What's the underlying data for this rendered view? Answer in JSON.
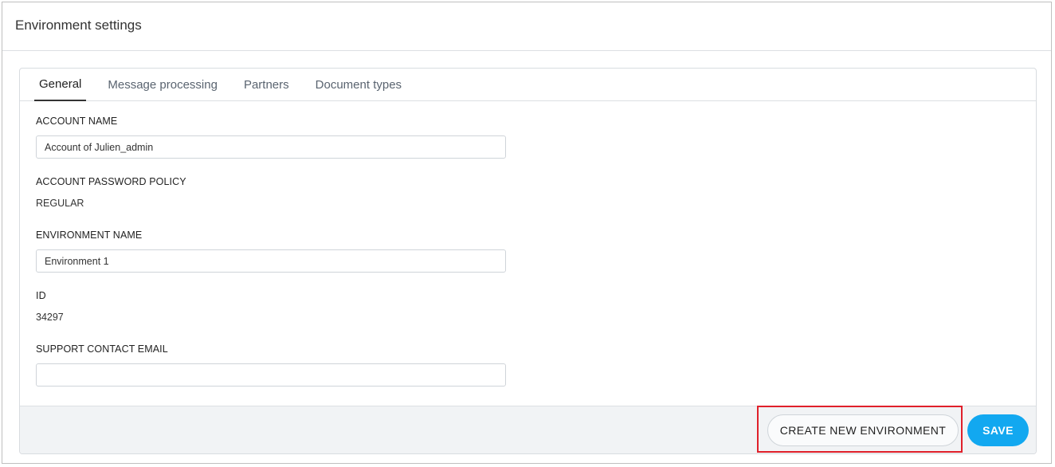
{
  "header": {
    "title": "Environment settings"
  },
  "tabs": [
    {
      "label": "General",
      "active": true
    },
    {
      "label": "Message processing",
      "active": false
    },
    {
      "label": "Partners",
      "active": false
    },
    {
      "label": "Document types",
      "active": false
    }
  ],
  "form": {
    "account_name": {
      "label": "ACCOUNT NAME",
      "value": "Account of Julien_admin"
    },
    "password_policy": {
      "label": "ACCOUNT PASSWORD POLICY",
      "value": "REGULAR"
    },
    "environment_name": {
      "label": "ENVIRONMENT NAME",
      "value": "Environment 1"
    },
    "id": {
      "label": "ID",
      "value": "34297"
    },
    "support_email": {
      "label": "SUPPORT CONTACT EMAIL",
      "value": ""
    }
  },
  "footer": {
    "create_label": "CREATE NEW ENVIRONMENT",
    "save_label": "SAVE"
  },
  "colors": {
    "accent": "#12a8f0",
    "highlight": "#e0202a",
    "footer_bg": "#f1f3f5"
  }
}
